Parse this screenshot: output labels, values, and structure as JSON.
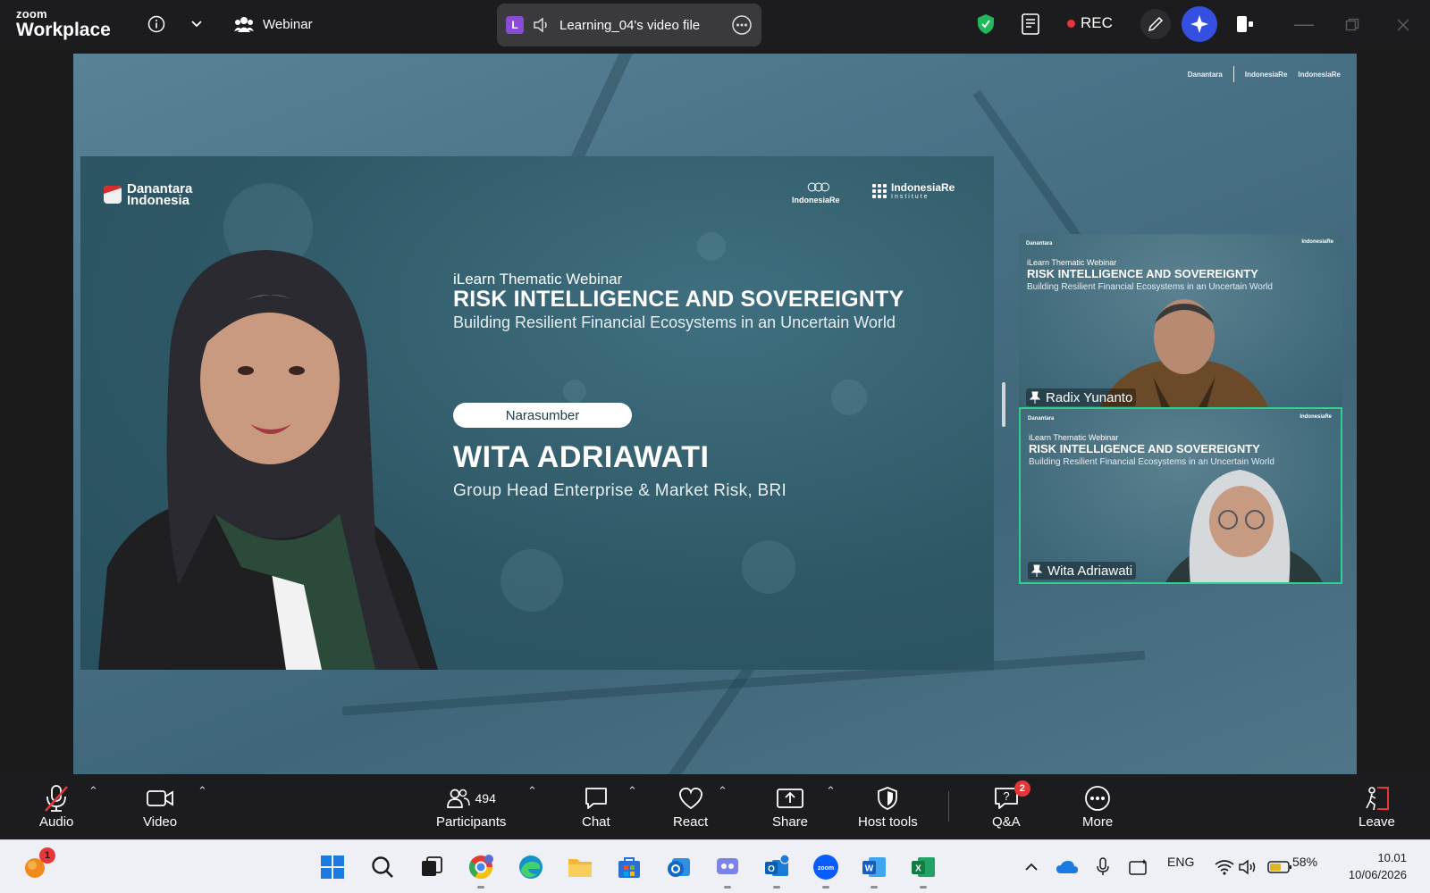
{
  "app": {
    "brand_small": "zoom",
    "brand_big": "Workplace"
  },
  "topbar": {
    "meeting_type": "Webinar",
    "share_pill": {
      "avatar_letter": "L",
      "title": "Learning_04's video file"
    },
    "rec_label": "REC"
  },
  "slide": {
    "brand_left_1": "Danantara",
    "brand_left_2": "Indonesia",
    "brand_re": "IndonesiaRe",
    "brand_inst": "IndonesiaRe",
    "brand_inst_sub": "Institute",
    "kicker": "iLearn Thematic Webinar",
    "title": "RISK INTELLIGENCE AND SOVEREIGNTY",
    "subtitle": "Building Resilient Financial Ecosystems in an Uncertain World",
    "role_pill": "Narasumber",
    "speaker_name": "WITA ADRIAWATI",
    "speaker_role": "Group Head Enterprise & Market Risk, BRI"
  },
  "tiles": [
    {
      "name": "Radix Yunanto",
      "kicker": "iLearn Thematic Webinar",
      "title": "RISK INTELLIGENCE AND SOVEREIGNTY",
      "subtitle": "Building Resilient Financial Ecosystems in an Uncertain World",
      "active": false
    },
    {
      "name": "Wita Adriawati",
      "kicker": "iLearn Thematic Webinar",
      "title": "RISK INTELLIGENCE AND SOVEREIGNTY",
      "subtitle": "Building Resilient Financial Ecosystems in an Uncertain World",
      "active": true
    }
  ],
  "toolbar": {
    "audio": "Audio",
    "video": "Video",
    "participants": "Participants",
    "participants_count": "494",
    "chat": "Chat",
    "react": "React",
    "share": "Share",
    "host_tools": "Host tools",
    "qa": "Q&A",
    "qa_badge": "2",
    "more": "More",
    "leave": "Leave"
  },
  "taskbar": {
    "notification_badge": "1",
    "language": "ENG",
    "battery": "58%",
    "time": "10.01",
    "date": "10/06/2026"
  },
  "colors": {
    "accent_green": "#2fd18a",
    "rec_red": "#e5373a",
    "topbar_bg": "#1c1c1e",
    "taskbar_bg": "#eef0f5"
  }
}
